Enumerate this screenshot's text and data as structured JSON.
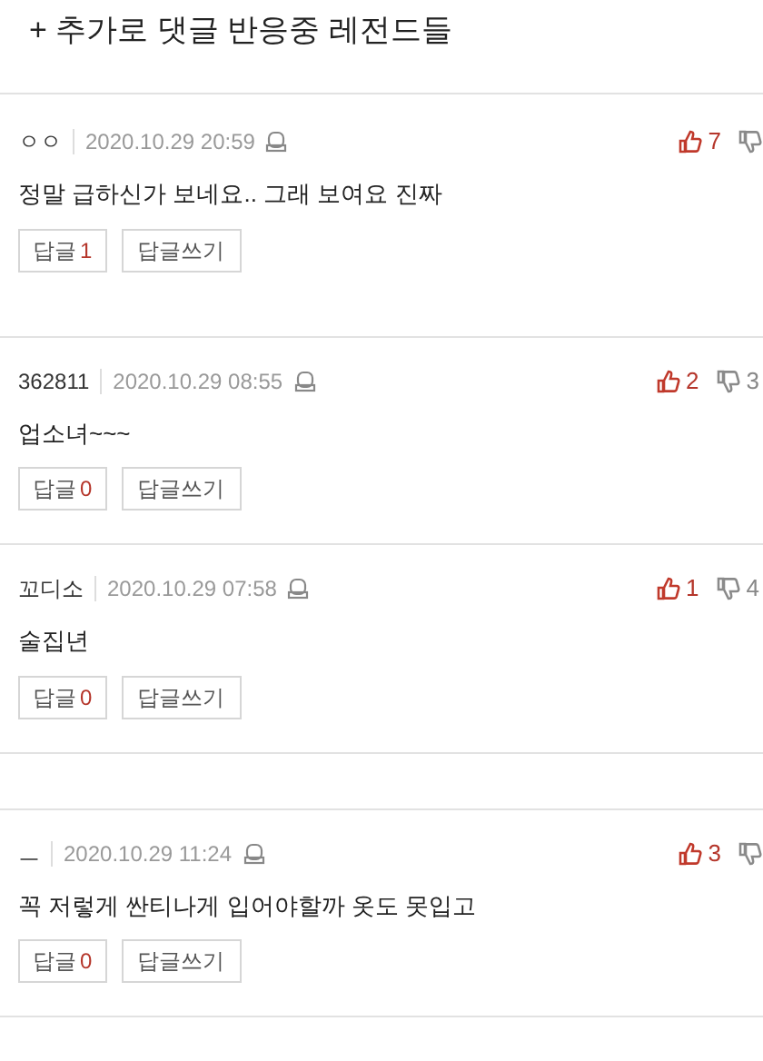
{
  "heading": "+ 추가로 댓글 반응중 레전드들",
  "comments": [
    {
      "author": "ㅇㅇ",
      "date": "2020.10.29 20:59",
      "text": "정말 급하신가 보네요.. 그래 보여요 진짜",
      "likes": "7",
      "reply_label": "답글",
      "reply_count": "1",
      "write_label": "답글쓰기"
    },
    {
      "author": "362811",
      "date": "2020.10.29 08:55",
      "text": "업소녀~~~",
      "likes": "2",
      "dislikes": "3",
      "reply_label": "답글",
      "reply_count": "0",
      "write_label": "답글쓰기"
    },
    {
      "author": "꼬디소",
      "date": "2020.10.29 07:58",
      "text": "술집년",
      "likes": "1",
      "dislikes": "4",
      "reply_label": "답글",
      "reply_count": "0",
      "write_label": "답글쓰기"
    },
    {
      "author": "ㅡ",
      "date": "2020.10.29 11:24",
      "text": "꼭 저렇게 싼티나게 입어야할까 옷도 못입고",
      "likes": "3",
      "reply_label": "답글",
      "reply_count": "0",
      "write_label": "답글쓰기"
    }
  ]
}
